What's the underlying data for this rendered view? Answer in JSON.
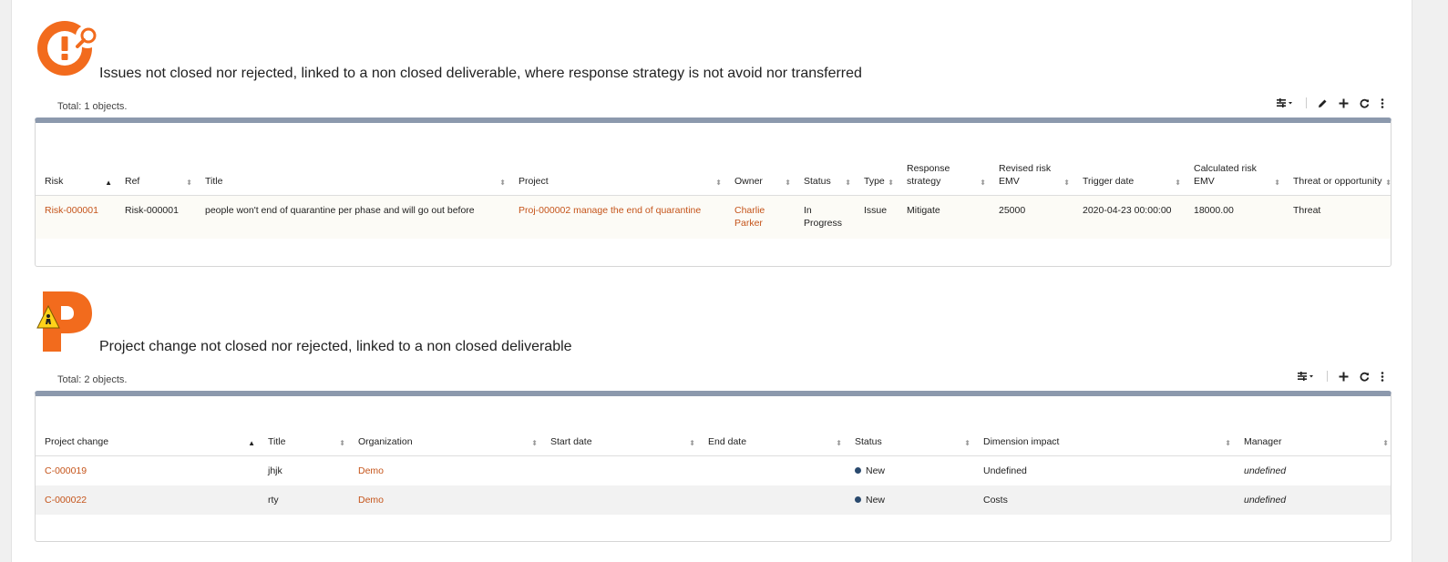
{
  "issues": {
    "title": "Issues not closed nor rejected, linked to a non closed deliverable, where response strategy is not avoid nor transferred",
    "total": "Total: 1 objects.",
    "columns": [
      "Risk",
      "Ref",
      "Title",
      "Project",
      "Owner",
      "Status",
      "Type",
      "Response strategy",
      "Revised risk EMV",
      "Trigger date",
      "Calculated risk EMV",
      "Threat or opportunity"
    ],
    "rows": [
      {
        "risk": "Risk-000001",
        "ref": "Risk-000001",
        "title": "people won't end of quarantine per phase and will go out before",
        "project": "Proj-000002 manage the end of quarantine",
        "owner": "Charlie Parker",
        "status": "In Progress",
        "type": "Issue",
        "response": "Mitigate",
        "revised_emv": "25000",
        "trigger_date": "2020-04-23 00:00:00",
        "calculated_emv": "18000.00",
        "threat": "Threat"
      }
    ]
  },
  "changes": {
    "title": "Project change not closed nor rejected, linked to a non closed deliverable",
    "total": "Total: 2 objects.",
    "columns": [
      "Project change",
      "Title",
      "Organization",
      "Start date",
      "End date",
      "Status",
      "Dimension impact",
      "Manager"
    ],
    "rows": [
      {
        "id": "C-000019",
        "title": "jhjk",
        "org": "Demo",
        "start": "",
        "end": "",
        "status": "New",
        "impact": "Undefined",
        "manager": "undefined"
      },
      {
        "id": "C-000022",
        "title": "rty",
        "org": "Demo",
        "start": "",
        "end": "",
        "status": "New",
        "impact": "Costs",
        "manager": "undefined"
      }
    ]
  },
  "icons": {
    "issue": "issue-magnifier-icon",
    "change": "project-change-icon",
    "columns": "columns-toggle-icon",
    "edit": "pencil-icon",
    "add": "plus-icon",
    "refresh": "refresh-icon",
    "more": "kebab-menu-icon"
  },
  "colors": {
    "accent": "#c5541a",
    "logo_orange": "#f26b1d",
    "header_bar": "#8c99ad",
    "status_dot": "#2a4a6e"
  }
}
